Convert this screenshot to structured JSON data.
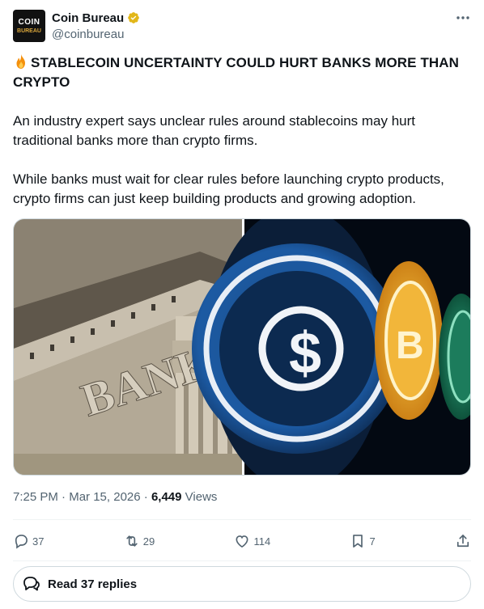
{
  "account": {
    "avatar_line1": "COIN",
    "avatar_line2": "BUREAU",
    "display_name": "Coin Bureau",
    "handle": "@coinbureau",
    "verified_color": "#e2b719"
  },
  "post": {
    "title": "STABLECOIN UNCERTAINTY COULD HURT BANKS MORE THAN CRYPTO",
    "paragraph1": "An industry expert says unclear rules around stablecoins may hurt traditional banks more than crypto firms.",
    "paragraph2": "While banks must wait for clear rules before launching crypto products, crypto firms can just keep building products and growing adoption.",
    "image_text": "BANK"
  },
  "meta": {
    "time": "7:25 PM",
    "date": "Mar 15, 2026",
    "views_count": "6,449",
    "views_label": "Views"
  },
  "actions": {
    "replies": "37",
    "reposts": "29",
    "likes": "114",
    "bookmarks": "7"
  },
  "read_replies_label": "Read 37 replies",
  "icons": [
    "more-icon",
    "verified-icon",
    "fire-icon",
    "reply-icon",
    "repost-icon",
    "like-icon",
    "bookmark-icon",
    "share-icon",
    "speech-bubbles-icon"
  ]
}
